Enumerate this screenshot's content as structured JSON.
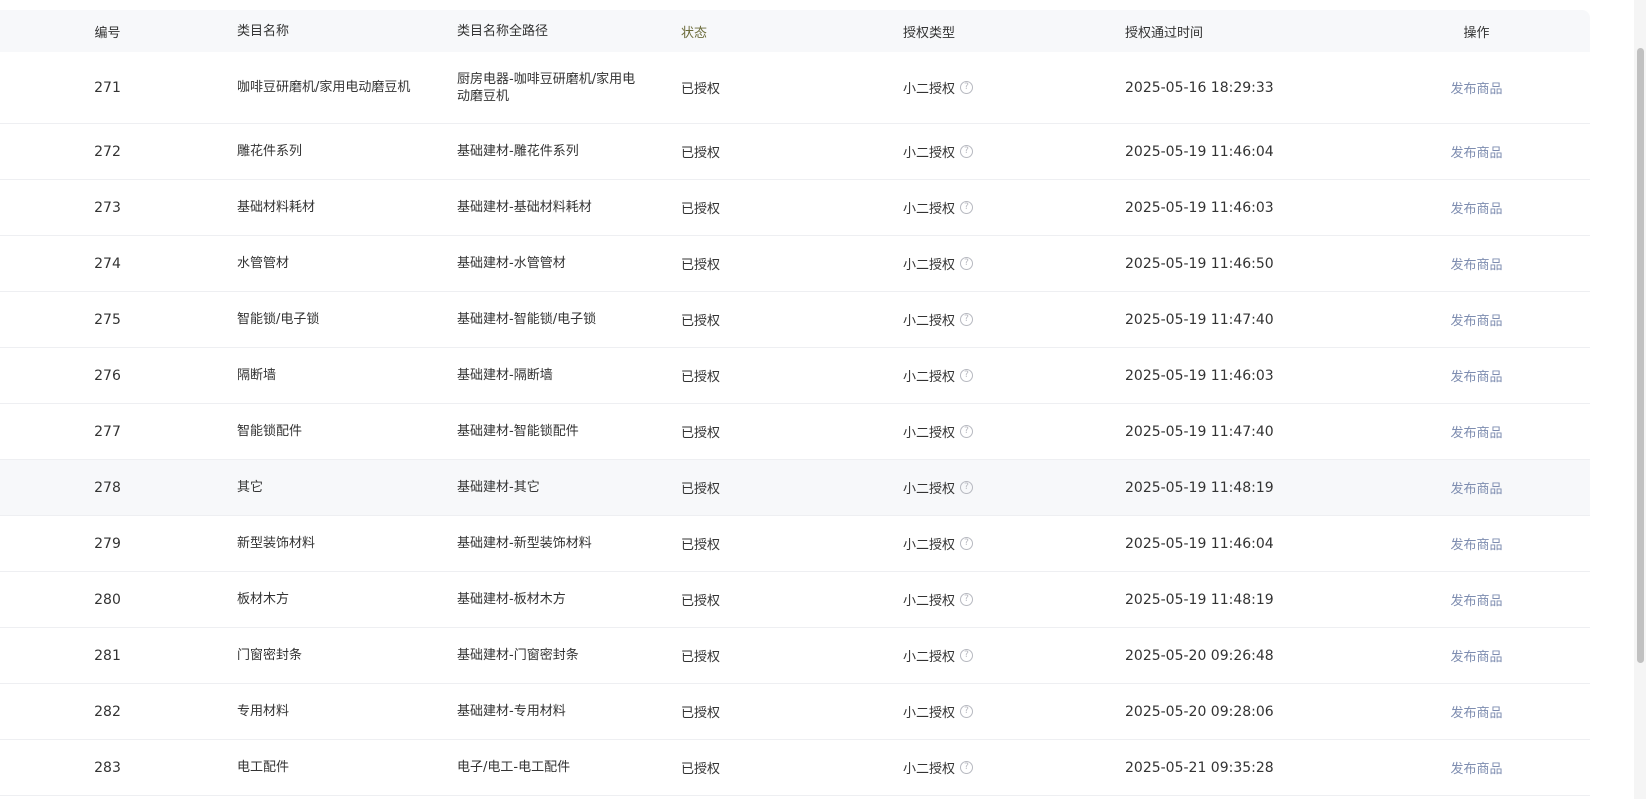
{
  "header": {
    "id": "编号",
    "name": "类目名称",
    "path": "类目名称全路径",
    "status": "状态",
    "auth_type": "授权类型",
    "auth_time": "授权通过时间",
    "action": "操作"
  },
  "rows": [
    {
      "id": "271",
      "name": "咖啡豆研磨机/家用电动磨豆机",
      "path": "厨房电器-咖啡豆研磨机/家用电动磨豆机",
      "status": "已授权",
      "auth_type": "小二授权",
      "time": "2025-05-16 18:29:33",
      "action": "发布商品"
    },
    {
      "id": "272",
      "name": "雕花件系列",
      "path": "基础建材-雕花件系列",
      "status": "已授权",
      "auth_type": "小二授权",
      "time": "2025-05-19 11:46:04",
      "action": "发布商品"
    },
    {
      "id": "273",
      "name": "基础材料耗材",
      "path": "基础建材-基础材料耗材",
      "status": "已授权",
      "auth_type": "小二授权",
      "time": "2025-05-19 11:46:03",
      "action": "发布商品"
    },
    {
      "id": "274",
      "name": "水管管材",
      "path": "基础建材-水管管材",
      "status": "已授权",
      "auth_type": "小二授权",
      "time": "2025-05-19 11:46:50",
      "action": "发布商品"
    },
    {
      "id": "275",
      "name": "智能锁/电子锁",
      "path": "基础建材-智能锁/电子锁",
      "status": "已授权",
      "auth_type": "小二授权",
      "time": "2025-05-19 11:47:40",
      "action": "发布商品"
    },
    {
      "id": "276",
      "name": "隔断墙",
      "path": "基础建材-隔断墙",
      "status": "已授权",
      "auth_type": "小二授权",
      "time": "2025-05-19 11:46:03",
      "action": "发布商品"
    },
    {
      "id": "277",
      "name": "智能锁配件",
      "path": "基础建材-智能锁配件",
      "status": "已授权",
      "auth_type": "小二授权",
      "time": "2025-05-19 11:47:40",
      "action": "发布商品"
    },
    {
      "id": "278",
      "name": "其它",
      "path": "基础建材-其它",
      "status": "已授权",
      "auth_type": "小二授权",
      "time": "2025-05-19 11:48:19",
      "action": "发布商品"
    },
    {
      "id": "279",
      "name": "新型装饰材料",
      "path": "基础建材-新型装饰材料",
      "status": "已授权",
      "auth_type": "小二授权",
      "time": "2025-05-19 11:46:04",
      "action": "发布商品"
    },
    {
      "id": "280",
      "name": "板材木方",
      "path": "基础建材-板材木方",
      "status": "已授权",
      "auth_type": "小二授权",
      "time": "2025-05-19 11:48:19",
      "action": "发布商品"
    },
    {
      "id": "281",
      "name": "门窗密封条",
      "path": "基础建材-门窗密封条",
      "status": "已授权",
      "auth_type": "小二授权",
      "time": "2025-05-20 09:26:48",
      "action": "发布商品"
    },
    {
      "id": "282",
      "name": "专用材料",
      "path": "基础建材-专用材料",
      "status": "已授权",
      "auth_type": "小二授权",
      "time": "2025-05-20 09:28:06",
      "action": "发布商品"
    },
    {
      "id": "283",
      "name": "电工配件",
      "path": "电子/电工-电工配件",
      "status": "已授权",
      "auth_type": "小二授权",
      "time": "2025-05-21 09:35:28",
      "action": "发布商品"
    }
  ],
  "icons": {
    "help": "question-circle-icon"
  },
  "colors": {
    "header_bg": "#f7f8fa",
    "link": "#7e8db0",
    "hover_row": "#f7f8fa"
  }
}
